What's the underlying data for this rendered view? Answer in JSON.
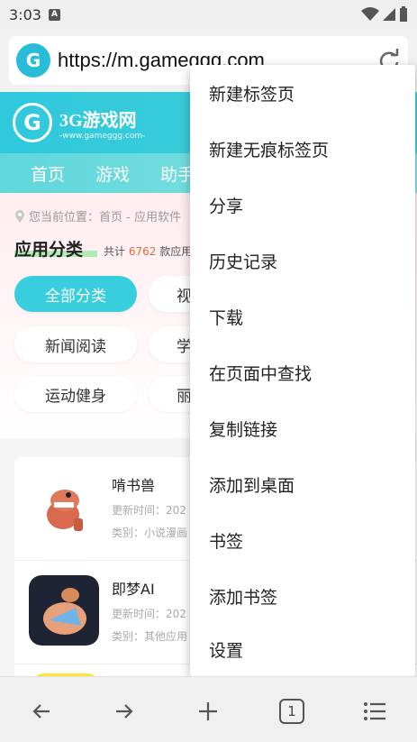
{
  "status": {
    "time": "3:03",
    "badge": "A"
  },
  "browser": {
    "url": "https://m.gameggg.com",
    "site_icon_letter": "G"
  },
  "site": {
    "logo_letter": "G",
    "logo_name": "3G游戏网",
    "logo_sub": "-www.gameggg.com-",
    "nav": [
      "首页",
      "游戏",
      "助手"
    ]
  },
  "breadcrumb": "您当前位置：首页 - 应用软件",
  "category": {
    "title": "应用分类",
    "count_prefix": "共计",
    "count": "6762",
    "count_suffix": "款应用",
    "pills": [
      "全部分类",
      "视",
      "新闻阅读",
      "学",
      "运动健身",
      "丽"
    ]
  },
  "apps": [
    {
      "name": "啃书兽",
      "updated": "更新时间：202",
      "type": "类别：小说漫画"
    },
    {
      "name": "即梦AI",
      "updated": "更新时间：202",
      "type": "类别：其他应用"
    }
  ],
  "menu": {
    "items": [
      "新建标签页",
      "新建无痕标签页",
      "分享",
      "历史记录",
      "下载",
      "在页面中查找",
      "复制链接",
      "添加到桌面",
      "书签",
      "添加书签",
      "设置"
    ]
  },
  "bottom_bar": {
    "tab_count": "1"
  }
}
